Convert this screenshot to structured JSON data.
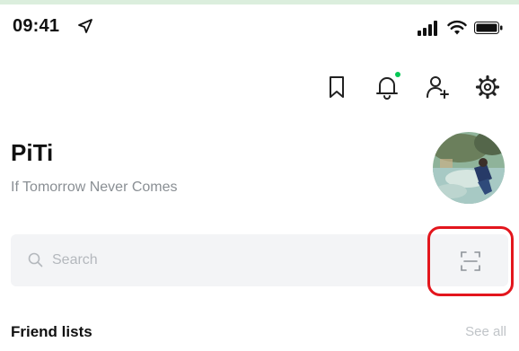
{
  "status_bar": {
    "time": "09:41"
  },
  "header": {
    "icons": [
      "bookmark-icon",
      "bell-icon",
      "add-friend-icon",
      "gear-icon"
    ],
    "notification_dot_color": "#06c755"
  },
  "profile": {
    "name": "PiTi",
    "status_message": "If Tomorrow Never Comes"
  },
  "search": {
    "placeholder": "Search",
    "value": ""
  },
  "scan": {
    "icon": "qr-scan-icon",
    "highlight_color": "#e3161d"
  },
  "friend_lists": {
    "title": "Friend lists",
    "see_all_label": "See all"
  }
}
